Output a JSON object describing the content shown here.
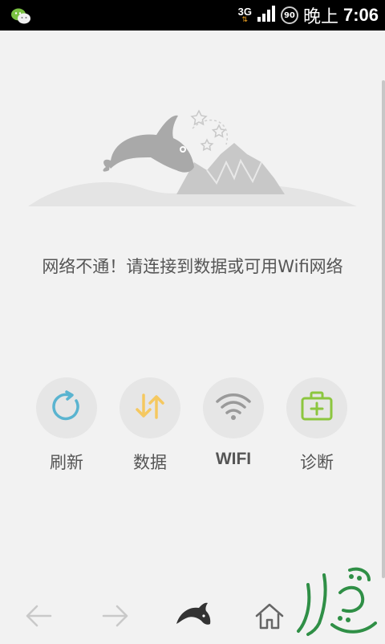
{
  "status_bar": {
    "network_type": "3G",
    "battery_level": "90",
    "period": "晚上",
    "time": "7:06",
    "icons": [
      "wechat-icon",
      "signal-icon",
      "battery-icon"
    ]
  },
  "main": {
    "message": "网络不通！请连接到数据或可用Wifi网络"
  },
  "actions": [
    {
      "label": "刷新",
      "icon": "refresh-icon",
      "color": "#5ab4d0"
    },
    {
      "label": "数据",
      "icon": "data-icon",
      "color": "#f5c860"
    },
    {
      "label": "WIFI",
      "icon": "wifi-icon",
      "color": "#9a9a9a"
    },
    {
      "label": "诊断",
      "icon": "diagnose-icon",
      "color": "#8cc63f"
    }
  ],
  "bottom_nav": {
    "icons": [
      "back-arrow-icon",
      "forward-arrow-icon",
      "dolphin-icon",
      "home-icon"
    ]
  },
  "colors": {
    "background": "#f2f2f2",
    "status_bar": "#000000",
    "text": "#555555"
  }
}
